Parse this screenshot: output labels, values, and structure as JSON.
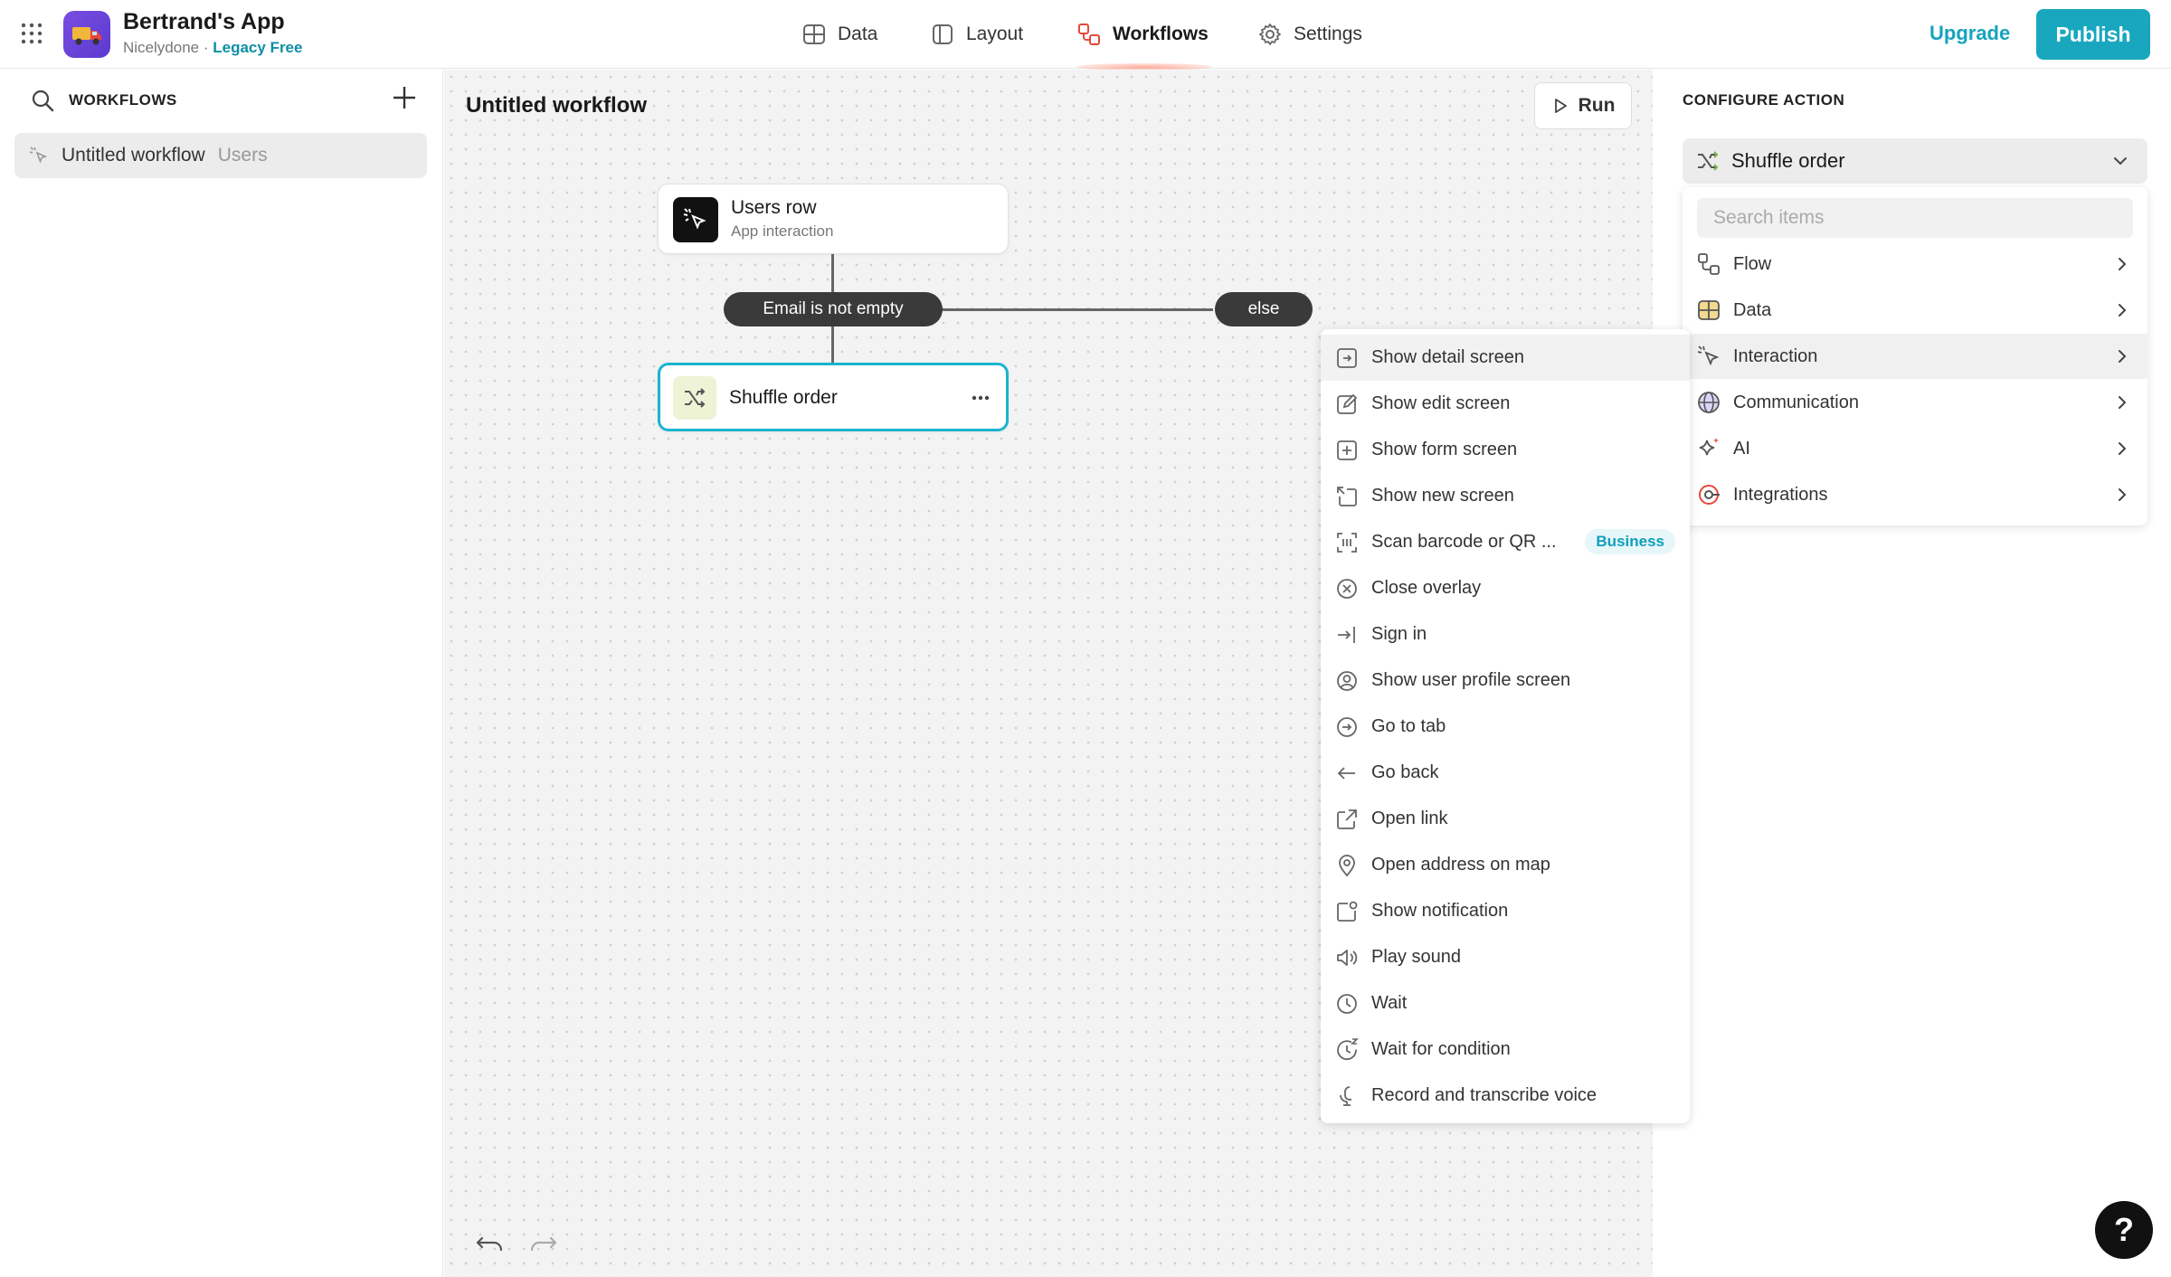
{
  "header": {
    "app_name": "Bertrand's App",
    "workspace": "Nicelydone",
    "separator": "·",
    "plan": "Legacy Free",
    "nav": [
      {
        "label": "Data"
      },
      {
        "label": "Layout"
      },
      {
        "label": "Workflows",
        "active": true
      },
      {
        "label": "Settings"
      }
    ],
    "upgrade_label": "Upgrade",
    "publish_label": "Publish",
    "accent_color": "#19a7c0"
  },
  "sidebar": {
    "title": "WORKFLOWS",
    "items": [
      {
        "label": "Untitled workflow",
        "sub": "Users"
      }
    ]
  },
  "canvas": {
    "title": "Untitled workflow",
    "run_label": "Run",
    "trigger": {
      "title": "Users row",
      "subtitle": "App interaction"
    },
    "condition": "Email is not empty",
    "else_label": "else",
    "action": {
      "title": "Shuffle order"
    }
  },
  "config": {
    "title": "CONFIGURE ACTION",
    "selected": "Shuffle order",
    "search_placeholder": "Search items",
    "categories": [
      {
        "label": "Flow",
        "icon": "flow-icon"
      },
      {
        "label": "Data",
        "icon": "table-icon"
      },
      {
        "label": "Interaction",
        "icon": "cursor-click-icon",
        "highlighted": true
      },
      {
        "label": "Communication",
        "icon": "globe-icon"
      },
      {
        "label": "AI",
        "icon": "sparkle-icon"
      },
      {
        "label": "Integrations",
        "icon": "integrations-icon"
      }
    ]
  },
  "interaction_menu": {
    "items": [
      {
        "label": "Show detail screen",
        "icon": "screen-arrow-icon",
        "highlighted": true
      },
      {
        "label": "Show edit screen",
        "icon": "edit-icon"
      },
      {
        "label": "Show form screen",
        "icon": "form-plus-icon"
      },
      {
        "label": "Show new screen",
        "icon": "new-screen-icon"
      },
      {
        "label": "Scan barcode or QR ...",
        "icon": "barcode-icon",
        "badge": "Business"
      },
      {
        "label": "Close overlay",
        "icon": "close-circle-icon"
      },
      {
        "label": "Sign in",
        "icon": "sign-in-icon"
      },
      {
        "label": "Show user profile screen",
        "icon": "user-circle-icon"
      },
      {
        "label": "Go to tab",
        "icon": "arrow-circle-icon"
      },
      {
        "label": "Go back",
        "icon": "arrow-left-icon"
      },
      {
        "label": "Open link",
        "icon": "external-link-icon"
      },
      {
        "label": "Open address on map",
        "icon": "map-pin-icon"
      },
      {
        "label": "Show notification",
        "icon": "notification-icon"
      },
      {
        "label": "Play sound",
        "icon": "speaker-icon"
      },
      {
        "label": "Wait",
        "icon": "clock-icon"
      },
      {
        "label": "Wait for condition",
        "icon": "clock-z-icon"
      },
      {
        "label": "Record and transcribe voice",
        "icon": "microphone-icon"
      }
    ]
  },
  "help_label": "?"
}
